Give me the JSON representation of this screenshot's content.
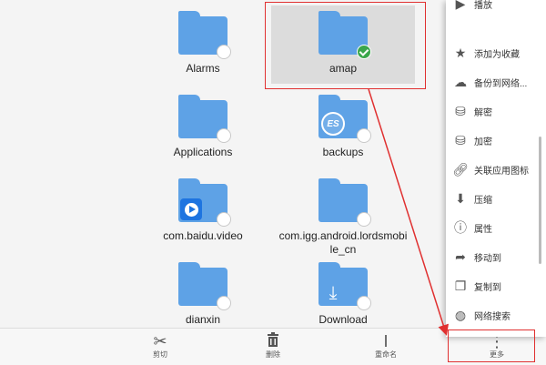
{
  "files": {
    "alarms": "Alarms",
    "amap": "amap",
    "applications": "Applications",
    "backups": "backups",
    "baidu_video": "com.baidu.video",
    "lords_mobile": "com.igg.android.lordsmobi le_cn",
    "dianxin": "dianxin",
    "download": "Download"
  },
  "badges": {
    "backups": "ES"
  },
  "toolbar": {
    "cut": "剪切",
    "delete": "删除",
    "rename": "重命名",
    "more": "更多"
  },
  "menu": {
    "top": "播放",
    "items": [
      {
        "label": "添加为收藏",
        "icon": "star-icon"
      },
      {
        "label": "备份到网络...",
        "icon": "cloud-upload-icon"
      },
      {
        "label": "解密",
        "icon": "database-lock-icon"
      },
      {
        "label": "加密",
        "icon": "database-lock-icon"
      },
      {
        "label": "关联应用图标",
        "icon": "link-icon"
      },
      {
        "label": "压缩",
        "icon": "compress-icon"
      },
      {
        "label": "属性",
        "icon": "info-icon"
      },
      {
        "label": "移动到",
        "icon": "move-arrow-icon"
      },
      {
        "label": "复制到",
        "icon": "copy-icon"
      },
      {
        "label": "网络搜索",
        "icon": "globe-search-icon"
      }
    ]
  },
  "colors": {
    "folder": "#5ea2e6",
    "check": "#3aa64a",
    "annotation": "#e03030"
  }
}
